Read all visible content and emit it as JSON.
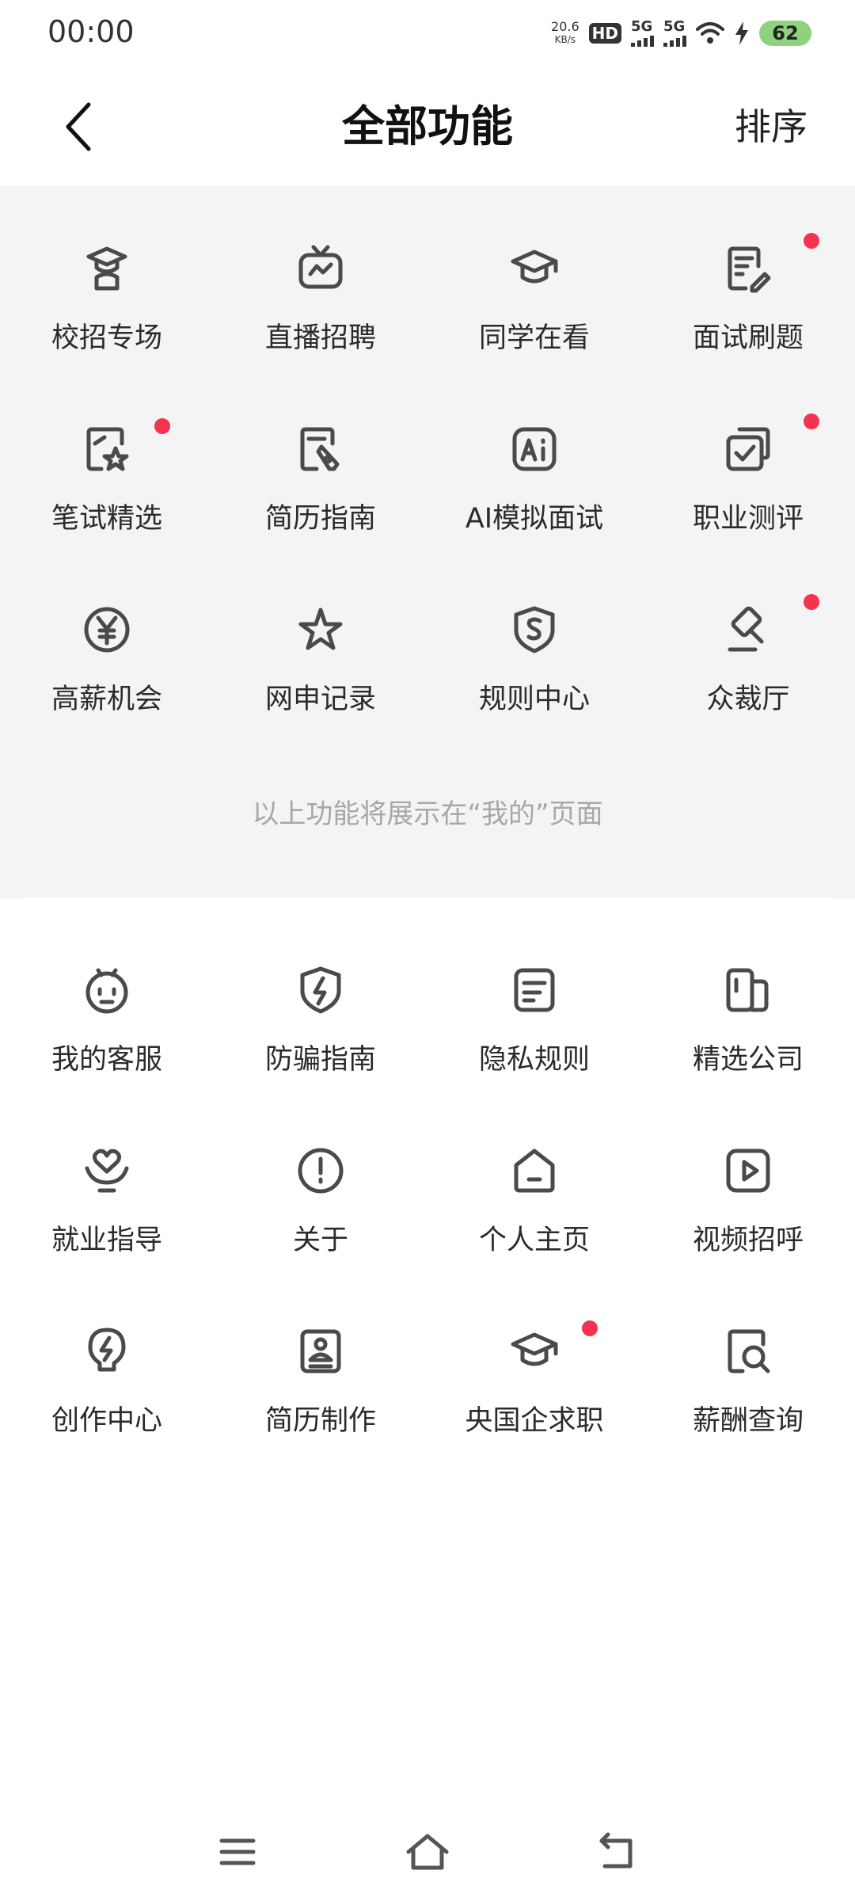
{
  "status": {
    "time": "00:00",
    "speed_value": "20.6",
    "speed_unit": "KB/s",
    "hd": "HD",
    "signal_label": "5G",
    "battery": "62"
  },
  "header": {
    "title": "全部功能",
    "sort_label": "排序"
  },
  "shown_section": {
    "items": [
      {
        "label": "校招专场",
        "icon": "graduate-person-icon",
        "badge": false
      },
      {
        "label": "直播招聘",
        "icon": "live-tv-icon",
        "badge": false
      },
      {
        "label": "同学在看",
        "icon": "graduation-cap-icon",
        "badge": false
      },
      {
        "label": "面试刷题",
        "icon": "document-edit-icon",
        "badge": true
      },
      {
        "label": "笔试精选",
        "icon": "star-image-icon",
        "badge": true
      },
      {
        "label": "简历指南",
        "icon": "resume-pen-icon",
        "badge": false
      },
      {
        "label": "AI模拟面试",
        "icon": "ai-box-icon",
        "badge": false
      },
      {
        "label": "职业测评",
        "icon": "check-card-icon",
        "badge": true
      },
      {
        "label": "高薪机会",
        "icon": "yen-coin-icon",
        "badge": false
      },
      {
        "label": "网申记录",
        "icon": "star-swoosh-icon",
        "badge": false
      },
      {
        "label": "规则中心",
        "icon": "shield-s-icon",
        "badge": false
      },
      {
        "label": "众裁厅",
        "icon": "gavel-icon",
        "badge": true
      }
    ],
    "note": "以上功能将展示在“我的”页面"
  },
  "more_section": {
    "items": [
      {
        "label": "我的客服",
        "icon": "robot-face-icon",
        "badge": false
      },
      {
        "label": "防骗指南",
        "icon": "shield-bolt-icon",
        "badge": false
      },
      {
        "label": "隐私规则",
        "icon": "privacy-doc-icon",
        "badge": false
      },
      {
        "label": "精选公司",
        "icon": "building-icon",
        "badge": false
      },
      {
        "label": "就业指导",
        "icon": "hand-heart-icon",
        "badge": false
      },
      {
        "label": "关于",
        "icon": "info-exclamation-icon",
        "badge": false
      },
      {
        "label": "个人主页",
        "icon": "home-icon",
        "badge": false
      },
      {
        "label": "视频招呼",
        "icon": "video-play-icon",
        "badge": false
      },
      {
        "label": "创作中心",
        "icon": "bulb-bolt-icon",
        "badge": false
      },
      {
        "label": "简历制作",
        "icon": "resume-person-icon",
        "badge": false
      },
      {
        "label": "央国企求职",
        "icon": "graduation-cap-icon",
        "badge": true
      },
      {
        "label": "薪酬查询",
        "icon": "search-doc-icon",
        "badge": false
      }
    ]
  },
  "colors": {
    "icon": "#4a4a4a",
    "badge": "#f5334f",
    "top_background": "#f4f4f4",
    "note_text": "#a7a7a7"
  }
}
